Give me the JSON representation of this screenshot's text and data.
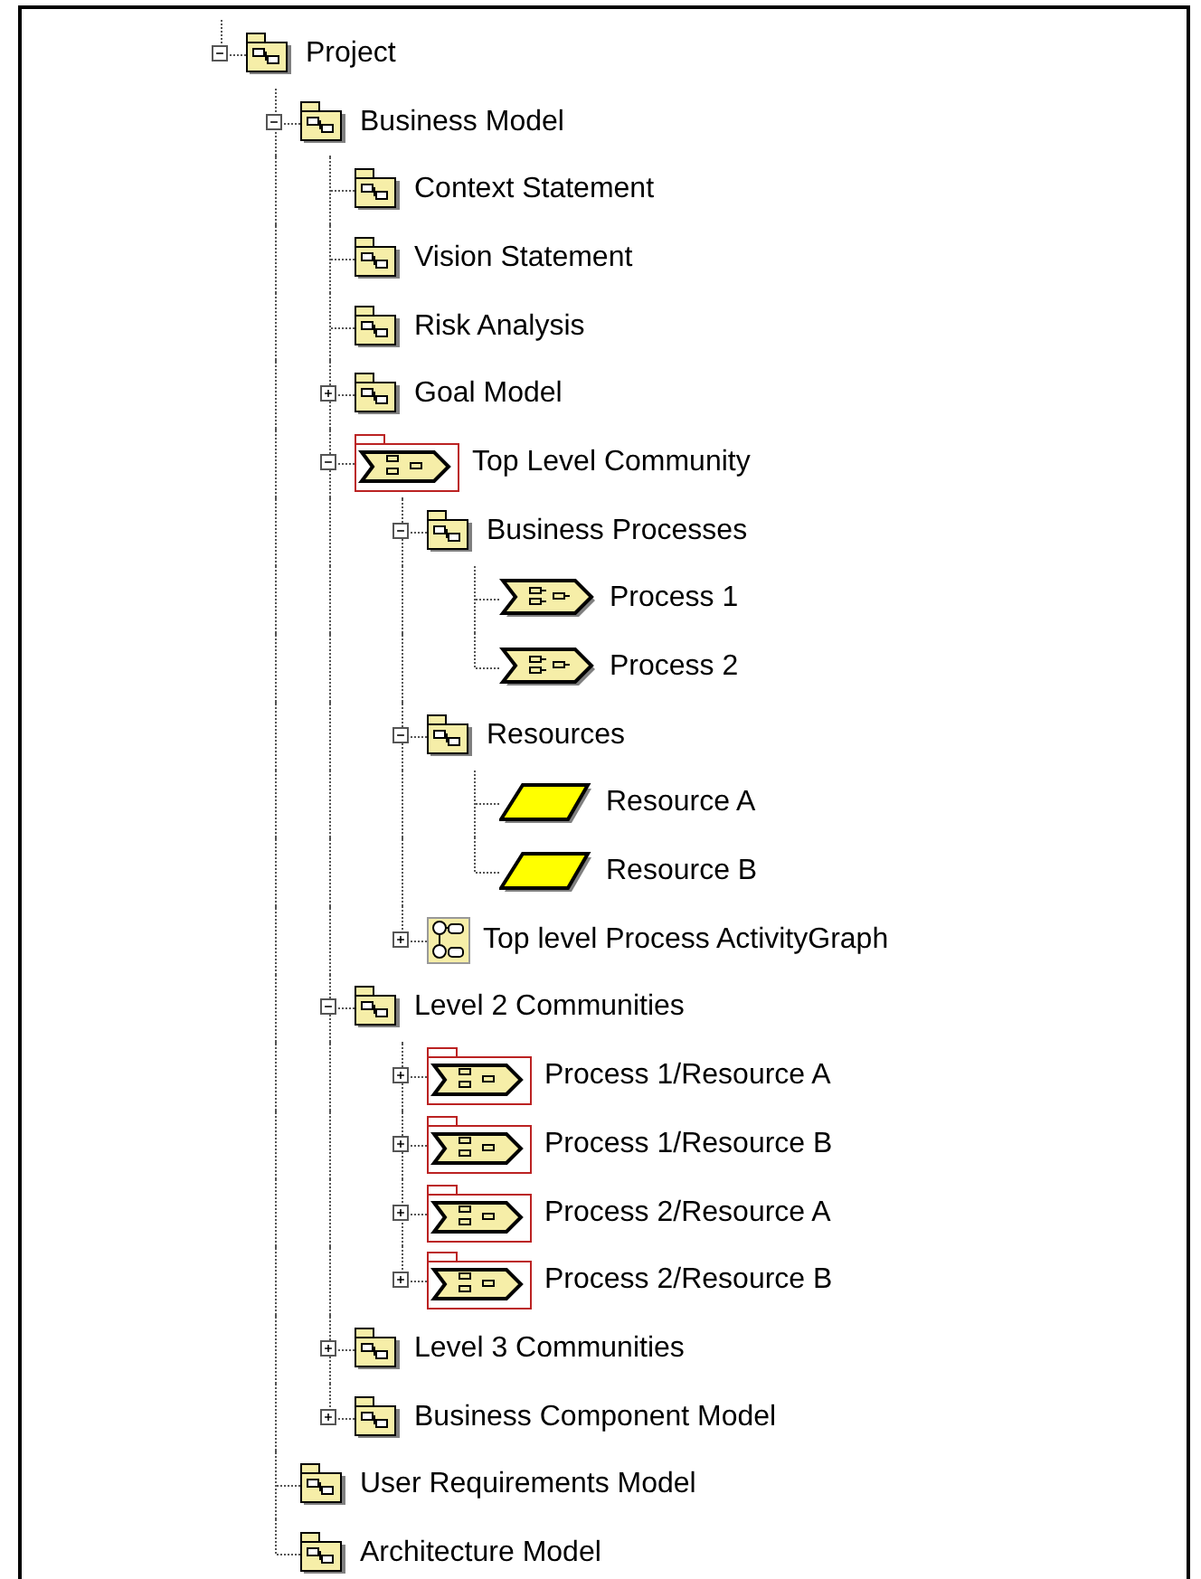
{
  "tree": [
    {
      "label": "Project",
      "kind": "package",
      "expanded": true,
      "children": [
        {
          "label": "Business Model",
          "kind": "package",
          "expanded": true,
          "children": [
            {
              "label": "Context Statement",
              "kind": "package"
            },
            {
              "label": "Vision Statement",
              "kind": "package"
            },
            {
              "label": "Risk Analysis",
              "kind": "package"
            },
            {
              "label": "Goal Model",
              "kind": "package",
              "expanded": false
            },
            {
              "label": "Top Level Community",
              "kind": "community",
              "expanded": true,
              "children": [
                {
                  "label": "Business Processes",
                  "kind": "package",
                  "expanded": true,
                  "children": [
                    {
                      "label": "Process 1",
                      "kind": "process"
                    },
                    {
                      "label": "Process 2",
                      "kind": "process"
                    }
                  ]
                },
                {
                  "label": "Resources",
                  "kind": "package",
                  "expanded": true,
                  "children": [
                    {
                      "label": "Resource A",
                      "kind": "resource"
                    },
                    {
                      "label": "Resource B",
                      "kind": "resource"
                    }
                  ]
                },
                {
                  "label": "Top level Process ActivityGraph",
                  "kind": "activity",
                  "expanded": false
                }
              ]
            },
            {
              "label": "Level 2 Communities",
              "kind": "package",
              "expanded": true,
              "children": [
                {
                  "label": "Process 1/Resource A",
                  "kind": "community",
                  "expanded": false
                },
                {
                  "label": "Process 1/Resource B",
                  "kind": "community",
                  "expanded": false
                },
                {
                  "label": "Process 2/Resource A",
                  "kind": "community",
                  "expanded": false
                },
                {
                  "label": "Process 2/Resource B",
                  "kind": "community",
                  "expanded": false
                }
              ]
            },
            {
              "label": "Level 3 Communities",
              "kind": "package",
              "expanded": false
            },
            {
              "label": "Business Component Model",
              "kind": "package",
              "expanded": false
            }
          ]
        },
        {
          "label": "User Requirements Model",
          "kind": "package"
        },
        {
          "label": "Architecture Model",
          "kind": "package"
        }
      ]
    }
  ]
}
